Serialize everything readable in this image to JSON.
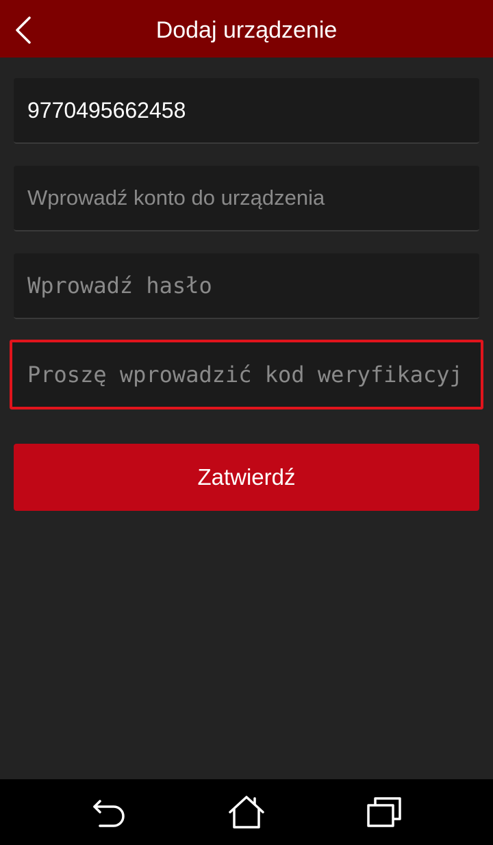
{
  "header": {
    "title": "Dodaj urządzenie",
    "back_icon": "chevron-left-icon"
  },
  "form": {
    "serial_value": "9770495662458",
    "account_placeholder": "Wprowadź konto do urządzenia",
    "password_placeholder": "Wprowadź hasło",
    "verification_placeholder": "Proszę wprowadzić kod weryfikacyj",
    "submit_label": "Zatwierdź"
  },
  "navbar": {
    "back_icon": "back-arrow-icon",
    "home_icon": "home-icon",
    "recent_icon": "recent-apps-icon"
  },
  "colors": {
    "header_bg": "#7d0000",
    "page_bg": "#232323",
    "field_bg": "#1b1b1b",
    "submit_bg": "#c00716",
    "highlight_border": "#e0141c"
  }
}
